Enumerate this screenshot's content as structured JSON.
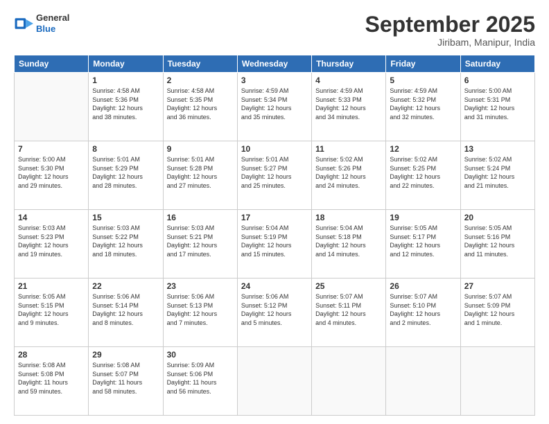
{
  "header": {
    "logo_general": "General",
    "logo_blue": "Blue",
    "month_title": "September 2025",
    "location": "Jiribam, Manipur, India"
  },
  "days_of_week": [
    "Sunday",
    "Monday",
    "Tuesday",
    "Wednesday",
    "Thursday",
    "Friday",
    "Saturday"
  ],
  "weeks": [
    [
      {
        "num": "",
        "text": ""
      },
      {
        "num": "1",
        "text": "Sunrise: 4:58 AM\nSunset: 5:36 PM\nDaylight: 12 hours\nand 38 minutes."
      },
      {
        "num": "2",
        "text": "Sunrise: 4:58 AM\nSunset: 5:35 PM\nDaylight: 12 hours\nand 36 minutes."
      },
      {
        "num": "3",
        "text": "Sunrise: 4:59 AM\nSunset: 5:34 PM\nDaylight: 12 hours\nand 35 minutes."
      },
      {
        "num": "4",
        "text": "Sunrise: 4:59 AM\nSunset: 5:33 PM\nDaylight: 12 hours\nand 34 minutes."
      },
      {
        "num": "5",
        "text": "Sunrise: 4:59 AM\nSunset: 5:32 PM\nDaylight: 12 hours\nand 32 minutes."
      },
      {
        "num": "6",
        "text": "Sunrise: 5:00 AM\nSunset: 5:31 PM\nDaylight: 12 hours\nand 31 minutes."
      }
    ],
    [
      {
        "num": "7",
        "text": "Sunrise: 5:00 AM\nSunset: 5:30 PM\nDaylight: 12 hours\nand 29 minutes."
      },
      {
        "num": "8",
        "text": "Sunrise: 5:01 AM\nSunset: 5:29 PM\nDaylight: 12 hours\nand 28 minutes."
      },
      {
        "num": "9",
        "text": "Sunrise: 5:01 AM\nSunset: 5:28 PM\nDaylight: 12 hours\nand 27 minutes."
      },
      {
        "num": "10",
        "text": "Sunrise: 5:01 AM\nSunset: 5:27 PM\nDaylight: 12 hours\nand 25 minutes."
      },
      {
        "num": "11",
        "text": "Sunrise: 5:02 AM\nSunset: 5:26 PM\nDaylight: 12 hours\nand 24 minutes."
      },
      {
        "num": "12",
        "text": "Sunrise: 5:02 AM\nSunset: 5:25 PM\nDaylight: 12 hours\nand 22 minutes."
      },
      {
        "num": "13",
        "text": "Sunrise: 5:02 AM\nSunset: 5:24 PM\nDaylight: 12 hours\nand 21 minutes."
      }
    ],
    [
      {
        "num": "14",
        "text": "Sunrise: 5:03 AM\nSunset: 5:23 PM\nDaylight: 12 hours\nand 19 minutes."
      },
      {
        "num": "15",
        "text": "Sunrise: 5:03 AM\nSunset: 5:22 PM\nDaylight: 12 hours\nand 18 minutes."
      },
      {
        "num": "16",
        "text": "Sunrise: 5:03 AM\nSunset: 5:21 PM\nDaylight: 12 hours\nand 17 minutes."
      },
      {
        "num": "17",
        "text": "Sunrise: 5:04 AM\nSunset: 5:19 PM\nDaylight: 12 hours\nand 15 minutes."
      },
      {
        "num": "18",
        "text": "Sunrise: 5:04 AM\nSunset: 5:18 PM\nDaylight: 12 hours\nand 14 minutes."
      },
      {
        "num": "19",
        "text": "Sunrise: 5:05 AM\nSunset: 5:17 PM\nDaylight: 12 hours\nand 12 minutes."
      },
      {
        "num": "20",
        "text": "Sunrise: 5:05 AM\nSunset: 5:16 PM\nDaylight: 12 hours\nand 11 minutes."
      }
    ],
    [
      {
        "num": "21",
        "text": "Sunrise: 5:05 AM\nSunset: 5:15 PM\nDaylight: 12 hours\nand 9 minutes."
      },
      {
        "num": "22",
        "text": "Sunrise: 5:06 AM\nSunset: 5:14 PM\nDaylight: 12 hours\nand 8 minutes."
      },
      {
        "num": "23",
        "text": "Sunrise: 5:06 AM\nSunset: 5:13 PM\nDaylight: 12 hours\nand 7 minutes."
      },
      {
        "num": "24",
        "text": "Sunrise: 5:06 AM\nSunset: 5:12 PM\nDaylight: 12 hours\nand 5 minutes."
      },
      {
        "num": "25",
        "text": "Sunrise: 5:07 AM\nSunset: 5:11 PM\nDaylight: 12 hours\nand 4 minutes."
      },
      {
        "num": "26",
        "text": "Sunrise: 5:07 AM\nSunset: 5:10 PM\nDaylight: 12 hours\nand 2 minutes."
      },
      {
        "num": "27",
        "text": "Sunrise: 5:07 AM\nSunset: 5:09 PM\nDaylight: 12 hours\nand 1 minute."
      }
    ],
    [
      {
        "num": "28",
        "text": "Sunrise: 5:08 AM\nSunset: 5:08 PM\nDaylight: 11 hours\nand 59 minutes."
      },
      {
        "num": "29",
        "text": "Sunrise: 5:08 AM\nSunset: 5:07 PM\nDaylight: 11 hours\nand 58 minutes."
      },
      {
        "num": "30",
        "text": "Sunrise: 5:09 AM\nSunset: 5:06 PM\nDaylight: 11 hours\nand 56 minutes."
      },
      {
        "num": "",
        "text": ""
      },
      {
        "num": "",
        "text": ""
      },
      {
        "num": "",
        "text": ""
      },
      {
        "num": "",
        "text": ""
      }
    ]
  ]
}
